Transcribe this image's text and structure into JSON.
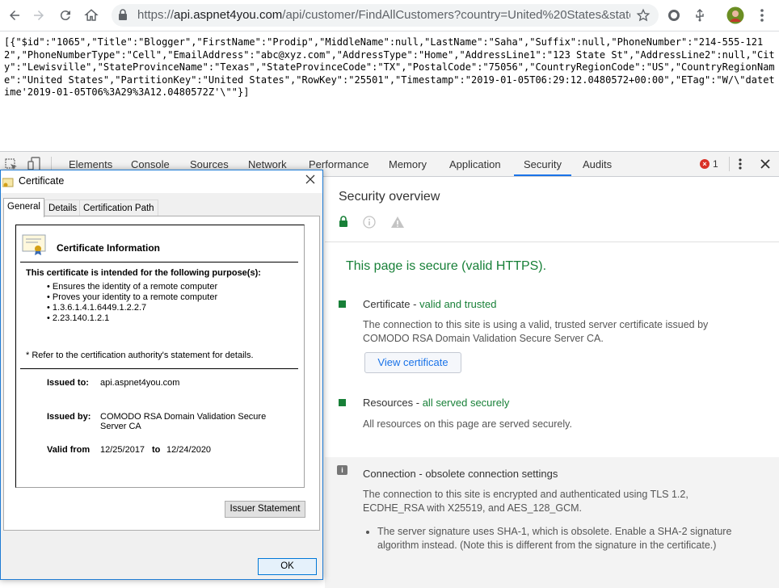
{
  "browser": {
    "url_scheme": "https://",
    "url_host": "api.aspnet4you.com",
    "url_path": "/api/customer/FindAllCustomers?country=United%20States&state=..."
  },
  "page": {
    "json_text": "[{\"$id\":\"1065\",\"Title\":\"Blogger\",\"FirstName\":\"Prodip\",\"MiddleName\":null,\"LastName\":\"Saha\",\"Suffix\":null,\"PhoneNumber\":\"214-555-1212\",\"PhoneNumberType\":\"Cell\",\"EmailAddress\":\"abc@xyz.com\",\"AddressType\":\"Home\",\"AddressLine1\":\"123 State St\",\"AddressLine2\":null,\"City\":\"Lewisville\",\"StateProvinceName\":\"Texas\",\"StateProvinceCode\":\"TX\",\"PostalCode\":\"75056\",\"CountryRegionCode\":\"US\",\"CountryRegionName\":\"United States\",\"PartitionKey\":\"United States\",\"RowKey\":\"25501\",\"Timestamp\":\"2019-01-05T06:29:12.0480572+00:00\",\"ETag\":\"W/\\\"datetime'2019-01-05T06%3A29%3A12.0480572Z'\\\"\"}]"
  },
  "devtools": {
    "tabs": [
      "Elements",
      "Console",
      "Sources",
      "Network",
      "Performance",
      "Memory",
      "Application",
      "Security",
      "Audits"
    ],
    "active_tab": "Security",
    "error_count": "1",
    "security": {
      "title": "Security overview",
      "secure_heading": "This page is secure (valid HTTPS).",
      "certificate_label": "Certificate",
      "certificate_status": "valid and trusted",
      "certificate_desc": "The connection to this site is using a valid, trusted server certificate issued by COMODO RSA Domain Validation Secure Server CA.",
      "view_certificate": "View certificate",
      "resources_label": "Resources",
      "resources_status": "all served securely",
      "resources_desc": "All resources on this page are served securely.",
      "connection_label": "Connection - obsolete connection settings",
      "connection_desc": "The connection to this site is encrypted and authenticated using TLS 1.2, ECDHE_RSA with X25519, and AES_128_GCM.",
      "connection_bullet": "The server signature uses SHA-1, which is obsolete. Enable a SHA-2 signature algorithm instead. (Note this is different from the signature in the certificate.)"
    },
    "colors": {
      "secure_green": "#188038",
      "accent_blue": "#1a73e8"
    }
  },
  "certificate_dialog": {
    "title": "Certificate",
    "tabs": [
      "General",
      "Details",
      "Certification Path"
    ],
    "active_tab": "General",
    "info_heading": "Certificate Information",
    "purpose_heading": "This certificate is intended for the following purpose(s):",
    "purposes": [
      "Ensures the identity of a remote computer",
      "Proves your identity to a remote computer",
      "1.3.6.1.4.1.6449.1.2.2.7",
      "2.23.140.1.2.1"
    ],
    "refer_note": "* Refer to the certification authority's statement for details.",
    "issued_to_label": "Issued to:",
    "issued_to": "api.aspnet4you.com",
    "issued_by_label": "Issued by:",
    "issued_by": "COMODO RSA Domain Validation Secure Server CA",
    "valid_from_label": "Valid from",
    "valid_from": "12/25/2017",
    "to_label": "to",
    "valid_to": "12/24/2020",
    "issuer_statement": "Issuer Statement",
    "ok": "OK"
  }
}
